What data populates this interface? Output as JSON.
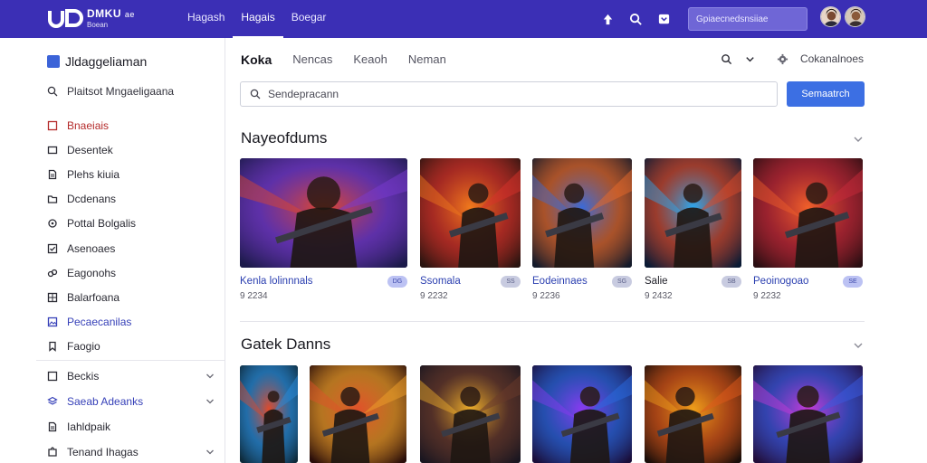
{
  "app": {
    "logo_name": "DMKU",
    "logo_sub": "Boean",
    "logo_extra": "ae"
  },
  "topnav": [
    {
      "label": "Hagash"
    },
    {
      "label": "Hagais"
    },
    {
      "label": "Boegar"
    }
  ],
  "top_search_placeholder": "Gpiaecnedsnsiiae",
  "sidebar": {
    "brand": "Jldaggeliaman",
    "search_label": "Plaitsot Mngaeligaana",
    "items": [
      {
        "label": "Bnaeiais",
        "icon": "square-outline-icon",
        "style": "red"
      },
      {
        "label": "Desentek",
        "icon": "rectangle-icon",
        "style": ""
      },
      {
        "label": "Plehs kiuia",
        "icon": "document-icon",
        "style": ""
      },
      {
        "label": "Dcdenans",
        "icon": "folder-icon",
        "style": ""
      },
      {
        "label": "Pottal Bolgalis",
        "icon": "gear-icon",
        "style": ""
      },
      {
        "label": "Asenoaes",
        "icon": "checkbox-icon",
        "style": ""
      },
      {
        "label": "Eagonohs",
        "icon": "link-icon",
        "style": ""
      },
      {
        "label": "Balarfoana",
        "icon": "grid-icon",
        "style": ""
      },
      {
        "label": "Pecaecanilas",
        "icon": "image-icon",
        "style": "blue"
      },
      {
        "label": "Faogio",
        "icon": "bookmark-icon",
        "style": ""
      }
    ],
    "groups": [
      {
        "label": "Beckis",
        "icon": "square-outline-icon",
        "style": "",
        "chevron": true
      },
      {
        "label": "Saeab Adeanks",
        "icon": "layers-icon",
        "style": "blue",
        "chevron": true
      },
      {
        "label": "Iahldpaik",
        "icon": "document-icon",
        "style": "",
        "chevron": false
      },
      {
        "label": "Tenand Ihagas",
        "icon": "puzzle-icon",
        "style": "",
        "chevron": true
      }
    ]
  },
  "main": {
    "tabs": [
      {
        "label": "Koka",
        "active": true
      },
      {
        "label": "Nencas",
        "active": false
      },
      {
        "label": "Keaoh",
        "active": false
      },
      {
        "label": "Neman",
        "active": false
      }
    ],
    "tools_label": "Cokanalnoes",
    "search_placeholder": "Sendepracann",
    "search_button": "Semaatrch",
    "section1_title": "Nayeofdums",
    "section2_title": "Gatek Danns",
    "cards": [
      {
        "title": "Kenla lolinnnals",
        "meta": "9 2234",
        "badge": "DG",
        "badge_style": "purple",
        "title_style": "link",
        "palette": [
          "#1c1a4a",
          "#e0462a",
          "#7a3ad0"
        ]
      },
      {
        "title": "Ssomala",
        "meta": "9 2232",
        "badge": "SS",
        "badge_style": "",
        "title_style": "link",
        "palette": [
          "#2a1410",
          "#f07a1c",
          "#d8322a"
        ]
      },
      {
        "title": "Eodeinnaes",
        "meta": "9 2236",
        "badge": "SG",
        "badge_style": "",
        "title_style": "link",
        "palette": [
          "#141a2a",
          "#3a6ad8",
          "#e86a2a"
        ]
      },
      {
        "title": "Salie",
        "meta": "9 2432",
        "badge": "SB",
        "badge_style": "",
        "title_style": "plain",
        "palette": [
          "#0a1a34",
          "#2aa8f0",
          "#d84a2a"
        ]
      },
      {
        "title": "Peoinogoao",
        "meta": "9 2232",
        "badge": "SE",
        "badge_style": "purple",
        "title_style": "link",
        "palette": [
          "#2a0e12",
          "#f0602a",
          "#c82a3a"
        ]
      }
    ],
    "cards2": [
      {
        "palette": [
          "#0e2a3a",
          "#e04a2a",
          "#2a8ad8"
        ]
      },
      {
        "palette": [
          "#2a0e0a",
          "#e0502a",
          "#f0a02a"
        ]
      },
      {
        "palette": [
          "#1a1620",
          "#f0b02a",
          "#6a3a2a"
        ]
      },
      {
        "palette": [
          "#1a0e3a",
          "#8a3af0",
          "#2a6ae0"
        ]
      },
      {
        "palette": [
          "#1a0e0a",
          "#f0a01a",
          "#e05a1a"
        ]
      },
      {
        "palette": [
          "#220e3a",
          "#c83ad8",
          "#3a5ae0"
        ]
      }
    ]
  }
}
